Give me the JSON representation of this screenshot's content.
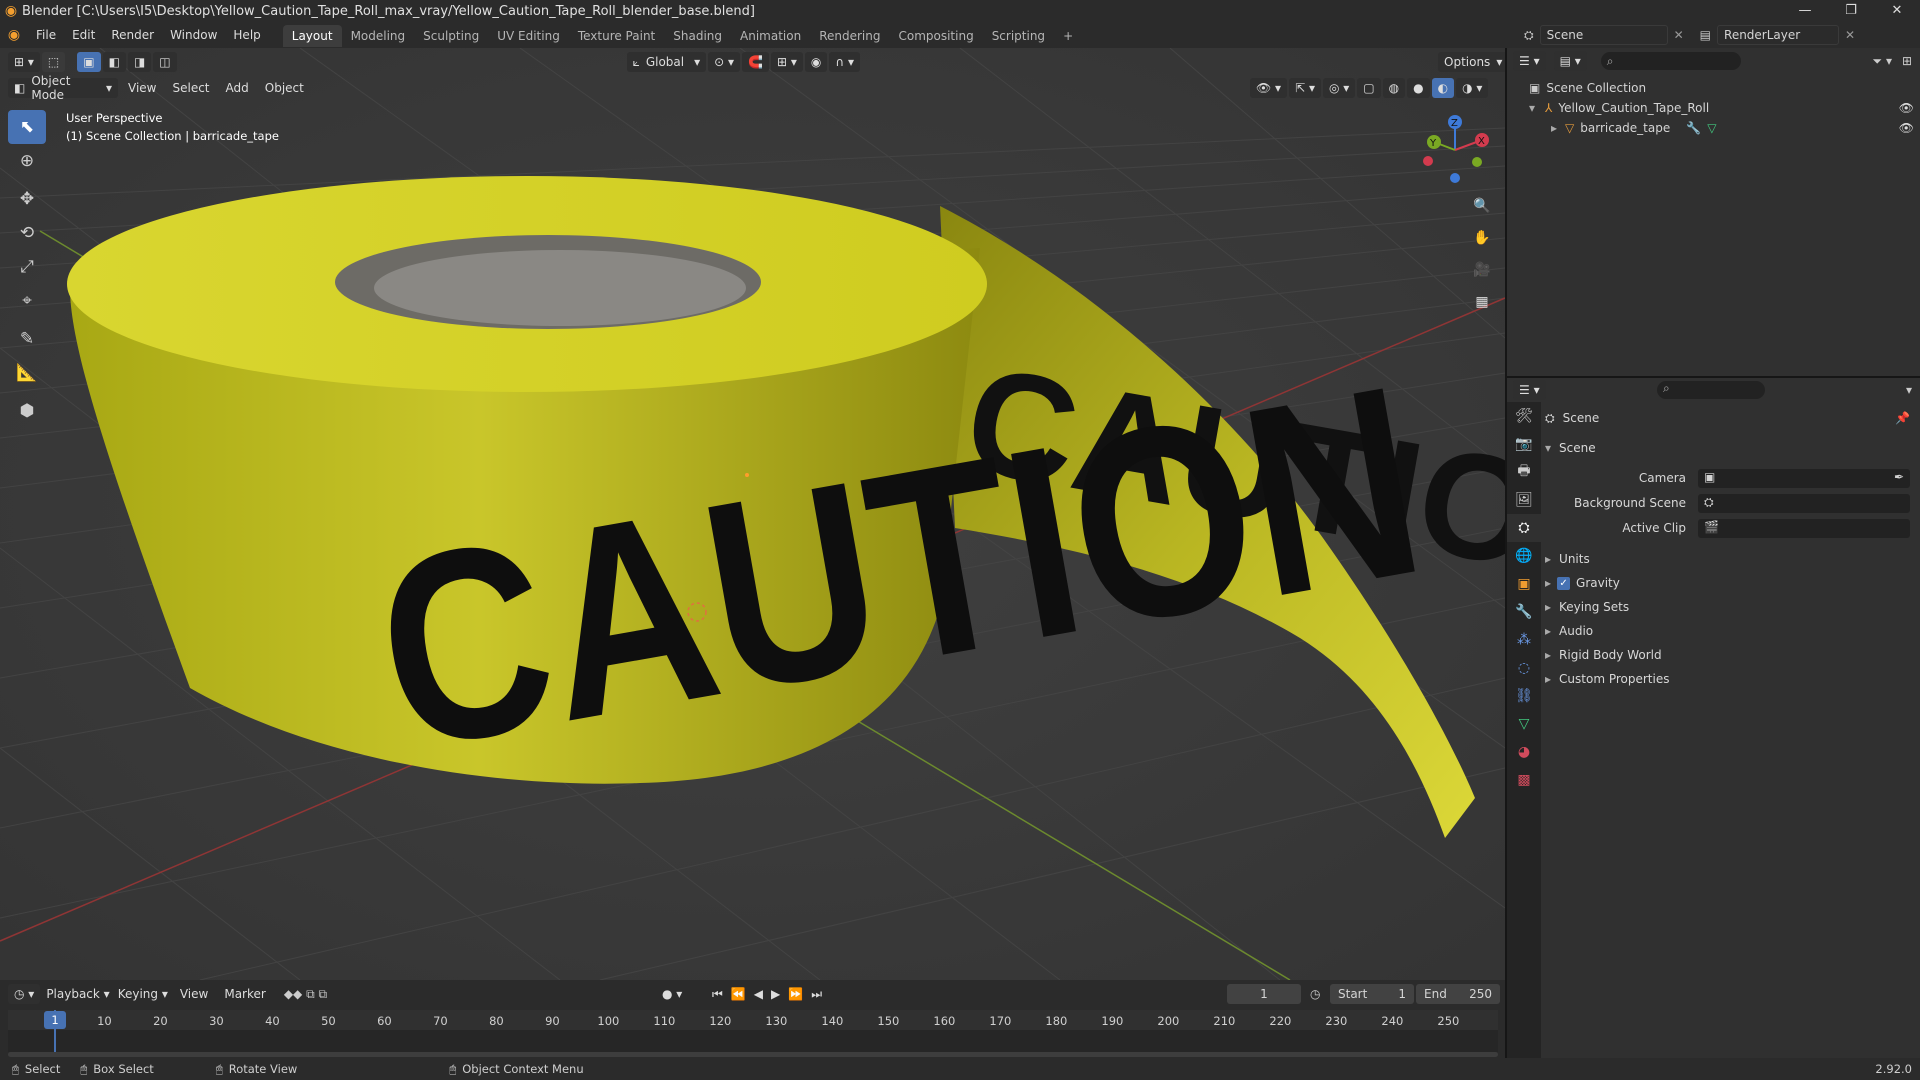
{
  "window": {
    "title": "Blender [C:\\Users\\I5\\Desktop\\Yellow_Caution_Tape_Roll_max_vray/Yellow_Caution_Tape_Roll_blender_base.blend]",
    "minimize": "—",
    "maximize": "❐",
    "close": "✕"
  },
  "menus": [
    "File",
    "Edit",
    "Render",
    "Window",
    "Help"
  ],
  "workspaces": [
    "Layout",
    "Modeling",
    "Sculpting",
    "UV Editing",
    "Texture Paint",
    "Shading",
    "Animation",
    "Rendering",
    "Compositing",
    "Scripting"
  ],
  "active_workspace": "Layout",
  "add_workspace": "+",
  "scene_selector": {
    "scene": "Scene",
    "render_layer": "RenderLayer"
  },
  "viewport_header": {
    "transform_orientation": "Global",
    "options": "Options",
    "mode": "Object Mode",
    "menu": [
      "View",
      "Select",
      "Add",
      "Object"
    ]
  },
  "viewport_overlay": {
    "line1": "User Perspective",
    "line2": "(1) Scene Collection | barricade_tape"
  },
  "gizmo_labels": {
    "x": "X",
    "y": "Y",
    "z": "Z"
  },
  "tape_text": "CAUTION",
  "outliner": {
    "root": "Scene Collection",
    "items": [
      {
        "label": "Yellow_Caution_Tape_Roll"
      },
      {
        "label": "barricade_tape"
      }
    ]
  },
  "properties": {
    "context": "Scene",
    "panel_title": "Scene",
    "fields": [
      {
        "label": "Camera"
      },
      {
        "label": "Background Scene"
      },
      {
        "label": "Active Clip"
      }
    ],
    "subpanels": [
      "Units",
      "Gravity",
      "Keying Sets",
      "Audio",
      "Rigid Body World",
      "Custom Properties"
    ],
    "gravity_checked": true
  },
  "timeline": {
    "menu": [
      "Playback",
      "Keying",
      "View",
      "Marker"
    ],
    "current_frame": "1",
    "start_label": "Start",
    "start": "1",
    "end_label": "End",
    "end": "250",
    "ticks": [
      "10",
      "20",
      "30",
      "40",
      "50",
      "60",
      "70",
      "80",
      "90",
      "100",
      "110",
      "120",
      "130",
      "140",
      "150",
      "160",
      "170",
      "180",
      "190",
      "200",
      "210",
      "220",
      "230",
      "240",
      "250"
    ],
    "playhead_label": "1"
  },
  "statusbar": {
    "select": "Select",
    "box_select": "Box Select",
    "rotate_view": "Rotate View",
    "context_menu": "Object Context Menu",
    "version": "2.92.0"
  }
}
